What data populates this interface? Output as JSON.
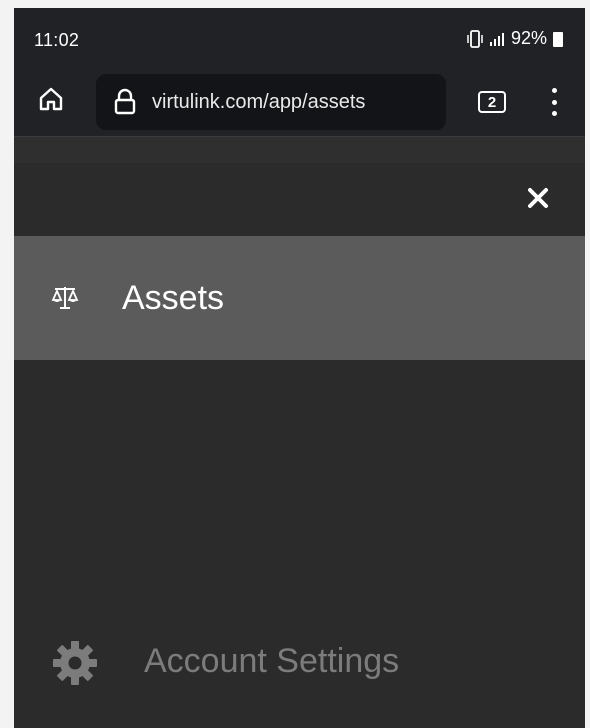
{
  "status_bar": {
    "time": "11:02",
    "battery_percent": "92%",
    "icons": [
      "vibrate-icon",
      "signal-icon",
      "battery-icon"
    ]
  },
  "browser": {
    "url": "virtulink.com/app/assets",
    "tab_count": "2",
    "icons": [
      "home-icon",
      "lock-icon",
      "tabs-icon",
      "more-vert-icon"
    ]
  },
  "drawer": {
    "close_icon": "close-icon",
    "items": [
      {
        "label": "Assets",
        "icon": "scale-icon",
        "selected": true
      },
      {
        "label": "Account Settings",
        "icon": "gear-icon",
        "selected": false
      }
    ]
  },
  "colors": {
    "chrome_background": "#212226",
    "drawer_background": "#2b2b2b",
    "selected_item_background": "#5b5b5b",
    "muted_text": "#7c7c7c"
  }
}
